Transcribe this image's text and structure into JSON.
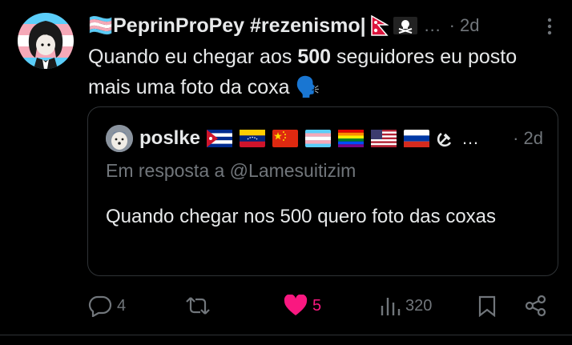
{
  "author": {
    "display_name": "🏳️‍⚧️PeprinProPey #rezenismo|",
    "ellipsis": "…",
    "time": "· 2d"
  },
  "tweet": {
    "text_before": "Quando eu chegar aos ",
    "text_bold": "500",
    "text_after": " seguidores eu posto mais uma foto da coxa 🗣️"
  },
  "quote": {
    "name": "poslke",
    "ellipsis": "…",
    "time": "· 2d",
    "reply_to": "Em resposta a @Lamesuitizim",
    "text": "Quando chegar nos 500 quero foto das coxas"
  },
  "actions": {
    "replies": "4",
    "likes": "5",
    "views": "320"
  },
  "colors": {
    "like": "#f91880",
    "muted": "#71767b",
    "text": "#e7e9ea"
  }
}
